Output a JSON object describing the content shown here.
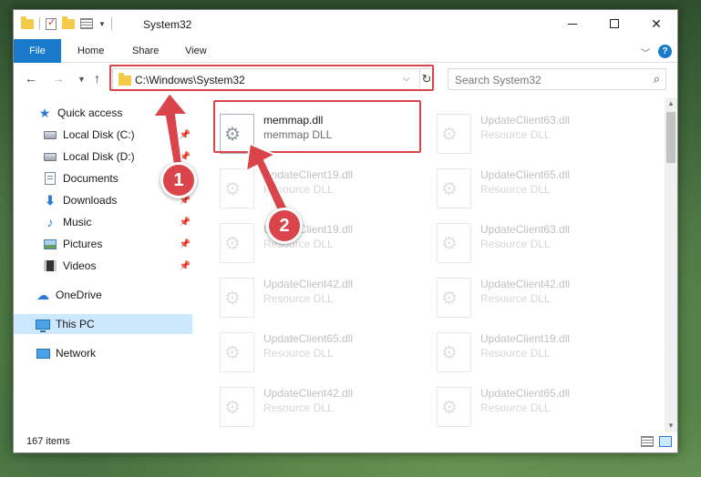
{
  "window": {
    "title": "System32",
    "controls": {
      "minimize": "–",
      "maximize": "",
      "close": "✕"
    }
  },
  "ribbon": {
    "tabs": [
      "File",
      "Home",
      "Share",
      "View"
    ],
    "help": "?"
  },
  "address": {
    "path": "C:\\Windows\\System32",
    "search_placeholder": "Search System32"
  },
  "sidebar": {
    "items": [
      {
        "label": "Quick access",
        "icon": "star-icon",
        "pinned": false
      },
      {
        "label": "Local Disk (C:)",
        "icon": "disk-icon",
        "pinned": true
      },
      {
        "label": "Local Disk (D:)",
        "icon": "disk-icon",
        "pinned": true
      },
      {
        "label": "Documents",
        "icon": "documents-icon",
        "pinned": true
      },
      {
        "label": "Downloads",
        "icon": "downloads-icon",
        "pinned": true
      },
      {
        "label": "Music",
        "icon": "music-icon",
        "pinned": true
      },
      {
        "label": "Pictures",
        "icon": "pictures-icon",
        "pinned": true
      },
      {
        "label": "Videos",
        "icon": "videos-icon",
        "pinned": true
      },
      {
        "label": "OneDrive",
        "icon": "onedrive-icon",
        "pinned": false
      },
      {
        "label": "This PC",
        "icon": "this-pc-icon",
        "pinned": false,
        "selected": true
      },
      {
        "label": "Network",
        "icon": "network-icon",
        "pinned": false
      }
    ]
  },
  "files": {
    "left": [
      {
        "name": "memmap.dll",
        "type": "memmap DLL",
        "highlighted": true
      },
      {
        "name": "UpdateClient19.dll",
        "type": "Resource DLL"
      },
      {
        "name": "UpdateClient19.dll",
        "type": "Resource DLL"
      },
      {
        "name": "UpdateClient42.dll",
        "type": "Resource DLL"
      },
      {
        "name": "UpdateClient65.dll",
        "type": "Resource DLL"
      },
      {
        "name": "UpdateClient42.dll",
        "type": "Resource DLL"
      }
    ],
    "right": [
      {
        "name": "UpdateClient63.dll",
        "type": "Resource DLL"
      },
      {
        "name": "UpdateClient65.dll",
        "type": "Resource DLL"
      },
      {
        "name": "UpdateClient63.dll",
        "type": "Resource DLL"
      },
      {
        "name": "UpdateClient42.dll",
        "type": "Resource DLL"
      },
      {
        "name": "UpdateClient19.dll",
        "type": "Resource DLL"
      },
      {
        "name": "UpdateClient65.dll",
        "type": "Resource DLL"
      }
    ]
  },
  "status": {
    "item_count": "167 items"
  },
  "annotations": {
    "step1": "1",
    "step2": "2",
    "color": "#d9454a"
  }
}
